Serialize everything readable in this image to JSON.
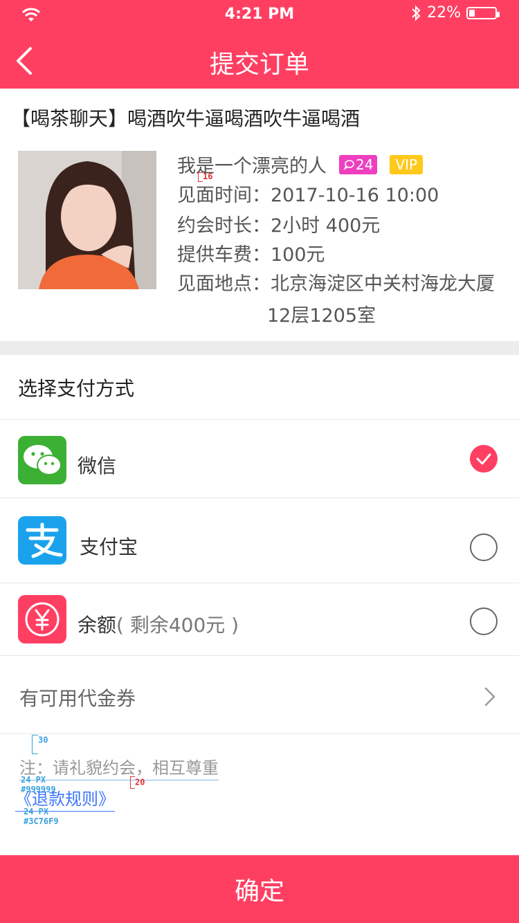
{
  "status_bar": {
    "time": "4:21 PM",
    "battery_percent": "22%",
    "battery_level": 0.22
  },
  "nav": {
    "title": "提交订单"
  },
  "order": {
    "title": "【喝茶聊天】喝酒吹牛逼喝酒吹牛逼喝酒",
    "name": "我是一个漂亮的人",
    "comment_count": "24",
    "vip": "VIP",
    "meet_time": "见面时间：2017-10-16  10:00",
    "duration": "约会时长：2小时  400元",
    "fare": "提供车费：100元",
    "place": "见面地点：北京海淀区中关村海龙大厦",
    "place_cont": "12层1205室"
  },
  "payment": {
    "heading": "选择支付方式",
    "wechat": "微信",
    "alipay": "支付宝",
    "balance": "余额",
    "balance_sub": "( 剩余400元 )",
    "selected": "wechat"
  },
  "coupon": {
    "label": "有可用代金券"
  },
  "notes": {
    "note": "注：请礼貌约会，相互尊重",
    "refund": "《退款规则》",
    "anno_16": "16",
    "anno_30": "30",
    "anno_20": "20",
    "anno_note_size": "24 PX",
    "anno_note_color": "#999999",
    "anno_refund_size": "24 PX",
    "anno_refund_color": "#3C76F9"
  },
  "confirm": {
    "label": "确定"
  },
  "colors": {
    "accent": "#ff3f62",
    "wechat": "#3cb034",
    "alipay": "#1aa3ec",
    "link": "#3c76f9"
  }
}
